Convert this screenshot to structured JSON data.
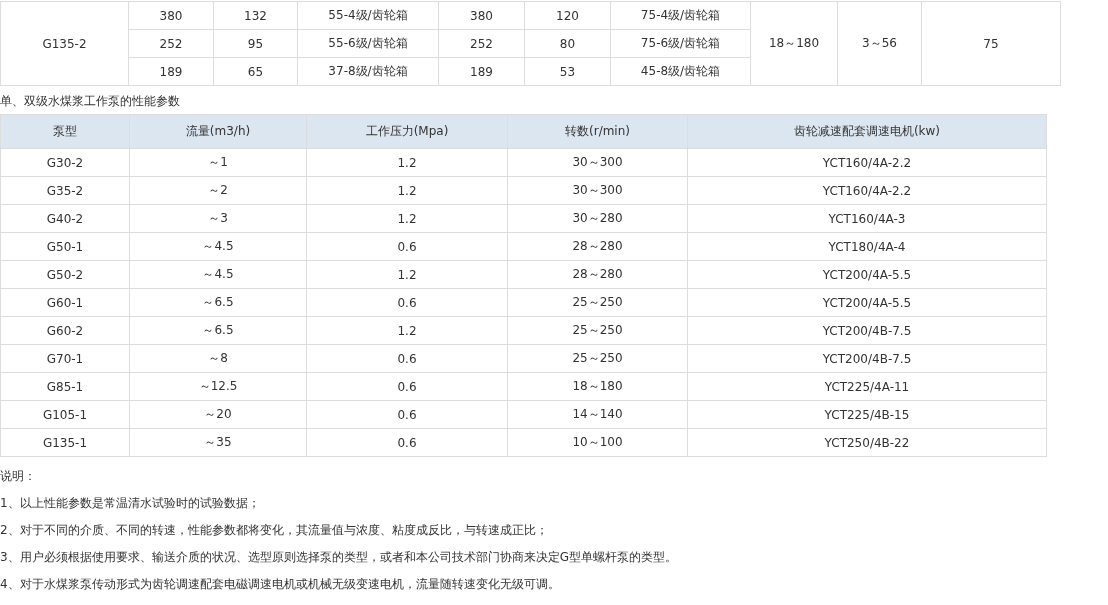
{
  "top_table": {
    "group": {
      "model": "G135-2",
      "rows": [
        [
          "380",
          "132",
          "55-4级/齿轮箱",
          "380",
          "120",
          "75-4级/齿轮箱"
        ],
        [
          "252",
          "95",
          "55-6级/齿轮箱",
          "252",
          "80",
          "75-6级/齿轮箱"
        ],
        [
          "189",
          "65",
          "37-8级/齿轮箱",
          "189",
          "53",
          "45-8级/齿轮箱"
        ]
      ],
      "column_8": "18～180",
      "column_9": "3～56",
      "column_10": "75"
    }
  },
  "caption": "单、双级水煤浆工作泵的性能参数",
  "table": {
    "columns": [
      "泵型",
      "流量(m3/h)",
      "工作压力(Mpa)",
      "转数(r/min)",
      "齿轮减速配套调速电机(kw)"
    ],
    "rows": [
      [
        "G30-2",
        "～1",
        "1.2",
        "30～300",
        "YCT160/4A-2.2"
      ],
      [
        "G35-2",
        "～2",
        "1.2",
        "30～300",
        "YCT160/4A-2.2"
      ],
      [
        "G40-2",
        "～3",
        "1.2",
        "30～280",
        "YCT160/4A-3"
      ],
      [
        "G50-1",
        "～4.5",
        "0.6",
        "28～280",
        "YCT180/4A-4"
      ],
      [
        "G50-2",
        "～4.5",
        "1.2",
        "28～280",
        "YCT200/4A-5.5"
      ],
      [
        "G60-1",
        "～6.5",
        "0.6",
        "25～250",
        "YCT200/4A-5.5"
      ],
      [
        "G60-2",
        "～6.5",
        "1.2",
        "25～250",
        "YCT200/4B-7.5"
      ],
      [
        "G70-1",
        "～8",
        "0.6",
        "25～250",
        "YCT200/4B-7.5"
      ],
      [
        "G85-1",
        "～12.5",
        "0.6",
        "18～180",
        "YCT225/4A-11"
      ],
      [
        "G105-1",
        "～20",
        "0.6",
        "14～140",
        "YCT225/4B-15"
      ],
      [
        "G135-1",
        "～35",
        "0.6",
        "10～100",
        "YCT250/4B-22"
      ]
    ]
  },
  "notes": {
    "title": "说明：",
    "items": [
      "1、以上性能参数是常温清水试验时的试验数据；",
      "2、对于不同的介质、不同的转速，性能参数都将变化，其流量值与浓度、粘度成反比，与转速成正比；",
      "3、用户必须根据使用要求、输送介质的状况、选型原则选择泵的类型，或者和本公司技术部门协商来决定G型单螺杆泵的类型。",
      "4、对于水煤浆泵传动形式为齿轮调速配套电磁调速电机或机械无级变速电机，流量随转速变化无级可调。"
    ]
  }
}
